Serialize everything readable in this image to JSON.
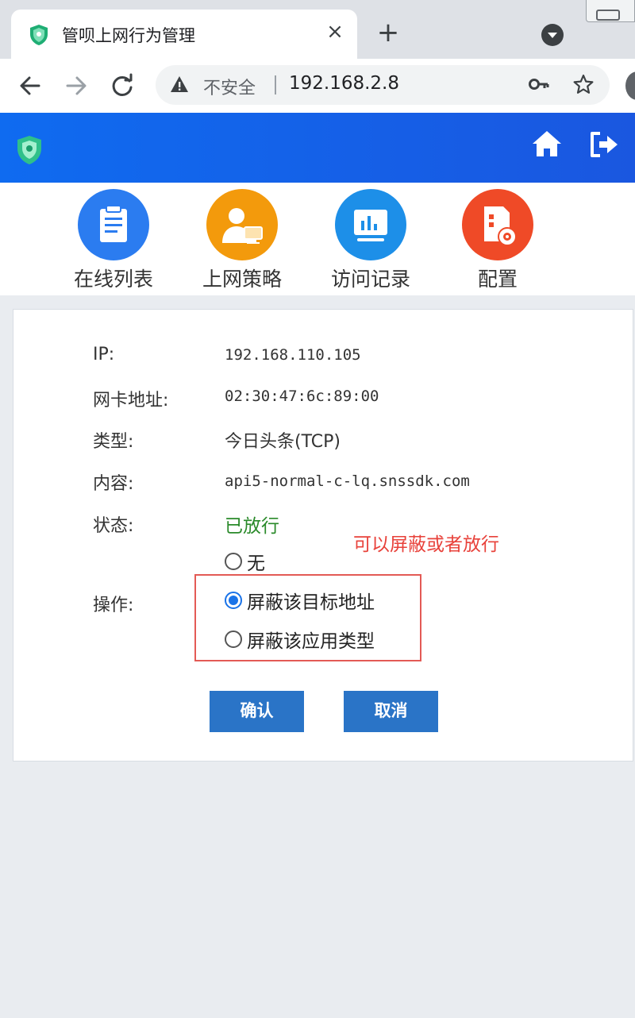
{
  "browser": {
    "tab_title": "管呗上网行为管理",
    "tab_close": "×",
    "new_tab": "+",
    "insecure_label": "不安全",
    "url": "192.168.2.8"
  },
  "nav": {
    "items": [
      {
        "label": "在线列表",
        "icon": "clipboard-icon",
        "color": "#2b7cf0"
      },
      {
        "label": "上网策略",
        "icon": "user-computer-icon",
        "color": "#f39a0c"
      },
      {
        "label": "访问记录",
        "icon": "chart-monitor-icon",
        "color": "#1d8fe8"
      },
      {
        "label": "配置",
        "icon": "settings-file-icon",
        "color": "#ef4a27"
      }
    ]
  },
  "detail": {
    "ip_label": "IP:",
    "ip_value": "192.168.110.105",
    "mac_label": "网卡地址:",
    "mac_value": "02:30:47:6c:89:00",
    "type_label": "类型:",
    "type_value": "今日头条(TCP)",
    "content_label": "内容:",
    "content_value": "api5-normal-c-lq.snssdk.com",
    "status_label": "状态:",
    "status_value": "已放行",
    "status_color": "#2a8a2a",
    "action_label": "操作:",
    "options": [
      {
        "label": "无",
        "selected": false
      },
      {
        "label": "屏蔽该目标地址",
        "selected": true
      },
      {
        "label": "屏蔽该应用类型",
        "selected": false
      }
    ],
    "annotation": "可以屏蔽或者放行",
    "confirm_label": "确认",
    "cancel_label": "取消"
  },
  "colors": {
    "header": "#1560e8",
    "button": "#2a74c7",
    "annotation": "#e8413a",
    "radio_selected": "#1a73e8"
  }
}
